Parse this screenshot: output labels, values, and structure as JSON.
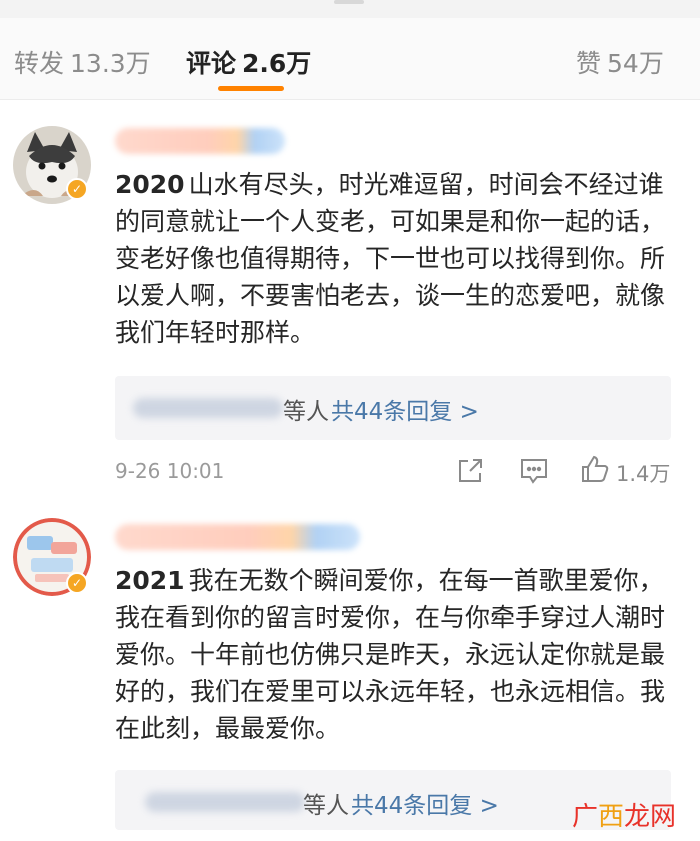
{
  "tabs": [
    {
      "label": "转发",
      "count": "13.3万",
      "active": false
    },
    {
      "label": "评论",
      "count": "2.6万",
      "active": true
    },
    {
      "label": "赞",
      "count": "54万",
      "active": false
    }
  ],
  "comments": [
    {
      "year": "2020",
      "body": "山水有尽头，时光难逗留，时间会不经过谁的同意就让一个人变老，可如果是和你一起的话，变老好像也值得期待，下一世也可以找得到你。所以爱人啊，不要害怕老去，谈一生的恋爱吧，就像我们年轻时那样。",
      "reply_people": "等人",
      "reply_link": "共44条回复 >",
      "time": "9-26 10:01",
      "likes": "1.4万"
    },
    {
      "year": "2021",
      "body": "我在无数个瞬间爱你，在每一首歌里爱你，我在看到你的留言时爱你，在与你牵手穿过人潮时爱你。十年前也仿佛只是昨天，永远认定你就是最好的，我们在爱里可以永远年轻，也永远相信。我在此刻，最最爱你。",
      "reply_people": "等人",
      "reply_link": "共44条回复 >"
    }
  ],
  "watermark": {
    "part1": "广",
    "part2": "西",
    "part3": "龙网"
  },
  "colors": {
    "accent": "#ff8200",
    "link": "#4a78a8",
    "verified": "#f5a623"
  }
}
